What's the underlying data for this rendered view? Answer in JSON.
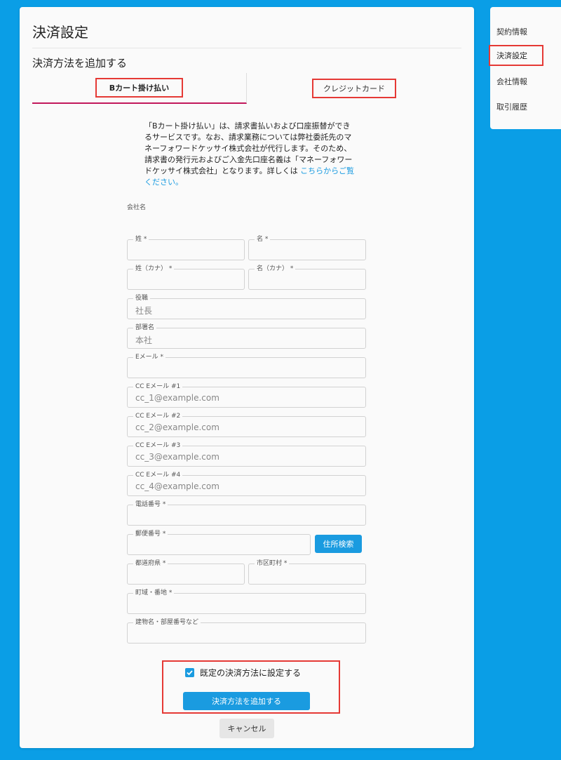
{
  "page": {
    "title": "決済設定",
    "section_title": "決済方法を追加する"
  },
  "tabs": [
    {
      "label": "Bカート掛け払い",
      "active": true
    },
    {
      "label": "クレジットカード",
      "active": false
    }
  ],
  "description": {
    "text": "「Bカート掛け払い」は、請求書払いおよび口座振替ができるサービスです。なお、請求業務については弊社委託先のマネーフォワードケッサイ株式会社が代行します。そのため、請求書の発行元およびご入金先口座名義は「マネーフォワードケッサイ株式会社」となります。詳しくは ",
    "link": "こちらからご覧ください。"
  },
  "form": {
    "company_label": "会社名",
    "last_name": {
      "label": "姓 *",
      "value": ""
    },
    "first_name": {
      "label": "名 *",
      "value": ""
    },
    "last_name_kana": {
      "label": "姓（カナ） *",
      "value": ""
    },
    "first_name_kana": {
      "label": "名（カナ） *",
      "value": ""
    },
    "position": {
      "label": "役職",
      "value": "社長"
    },
    "department": {
      "label": "部署名",
      "value": "本社"
    },
    "email": {
      "label": "Eメール *",
      "value": ""
    },
    "cc1": {
      "label": "CC Eメール #1",
      "value": "cc_1@example.com"
    },
    "cc2": {
      "label": "CC Eメール #2",
      "value": "cc_2@example.com"
    },
    "cc3": {
      "label": "CC Eメール #3",
      "value": "cc_3@example.com"
    },
    "cc4": {
      "label": "CC Eメール #4",
      "value": "cc_4@example.com"
    },
    "phone": {
      "label": "電話番号 *",
      "value": ""
    },
    "postal": {
      "label": "郵便番号 *",
      "value": ""
    },
    "address_search_label": "住所検索",
    "prefecture": {
      "label": "都道府県 *",
      "value": ""
    },
    "city": {
      "label": "市区町村 *",
      "value": ""
    },
    "street": {
      "label": "町域・番地 *",
      "value": ""
    },
    "building": {
      "label": "建物名・部屋番号など",
      "value": ""
    }
  },
  "actions": {
    "default_checkbox_label": "既定の決済方法に設定する",
    "default_checked": true,
    "add_label": "決済方法を追加する",
    "cancel_label": "キャンセル"
  },
  "sidenav": {
    "items": [
      "契約情報",
      "決済設定",
      "会社情報",
      "取引履歴"
    ],
    "active_index": 1
  },
  "colors": {
    "background": "#0a9ee6",
    "primary": "#1a9be0",
    "highlight": "#e53935",
    "tab_underline": "#c2185b"
  }
}
